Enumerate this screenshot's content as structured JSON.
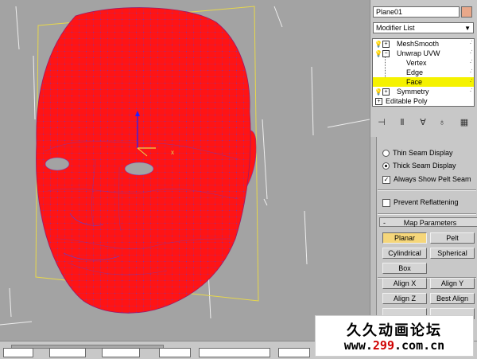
{
  "object_name": "Plane01",
  "modifier_list": {
    "label": "Modifier List"
  },
  "stack": {
    "items": [
      {
        "label": "MeshSmooth",
        "kind": "modifier"
      },
      {
        "label": "Unwrap UVW",
        "kind": "modifier-expanded"
      },
      {
        "label": "Vertex",
        "kind": "sub"
      },
      {
        "label": "Edge",
        "kind": "sub"
      },
      {
        "label": "Face",
        "kind": "sub",
        "selected": true
      },
      {
        "label": "Symmetry",
        "kind": "modifier"
      },
      {
        "label": "Editable Poly",
        "kind": "base"
      }
    ]
  },
  "seam_options": {
    "thin_seam": "Thin Seam Display",
    "thick_seam": "Thick Seam Display",
    "always_show_pelt": "Always Show Pelt Seam",
    "prevent_reflattening": "Prevent Reflattening"
  },
  "map_parameters": {
    "title": "Map Parameters",
    "sign": "-",
    "planar": "Planar",
    "pelt": "Pelt",
    "cylindrical": "Cylindrical",
    "spherical": "Spherical",
    "box": "Box",
    "align_x": "Align X",
    "align_y": "Align Y",
    "align_z": "Align Z",
    "best_align": "Best Align"
  },
  "watermark": {
    "title": "久久动画论坛",
    "url_prefix": "www.",
    "url_number": "299",
    "url_suffix": ".com.cn"
  },
  "colors": {
    "mesh": "#ff1414",
    "wire": "#7a3ab0",
    "gizmo": "#e8d84a",
    "selection_highlight": "#f5f200",
    "active_button": "#f5d67a",
    "viewport_bg": "#a3a3a3",
    "object_color": "#e8a88a"
  }
}
